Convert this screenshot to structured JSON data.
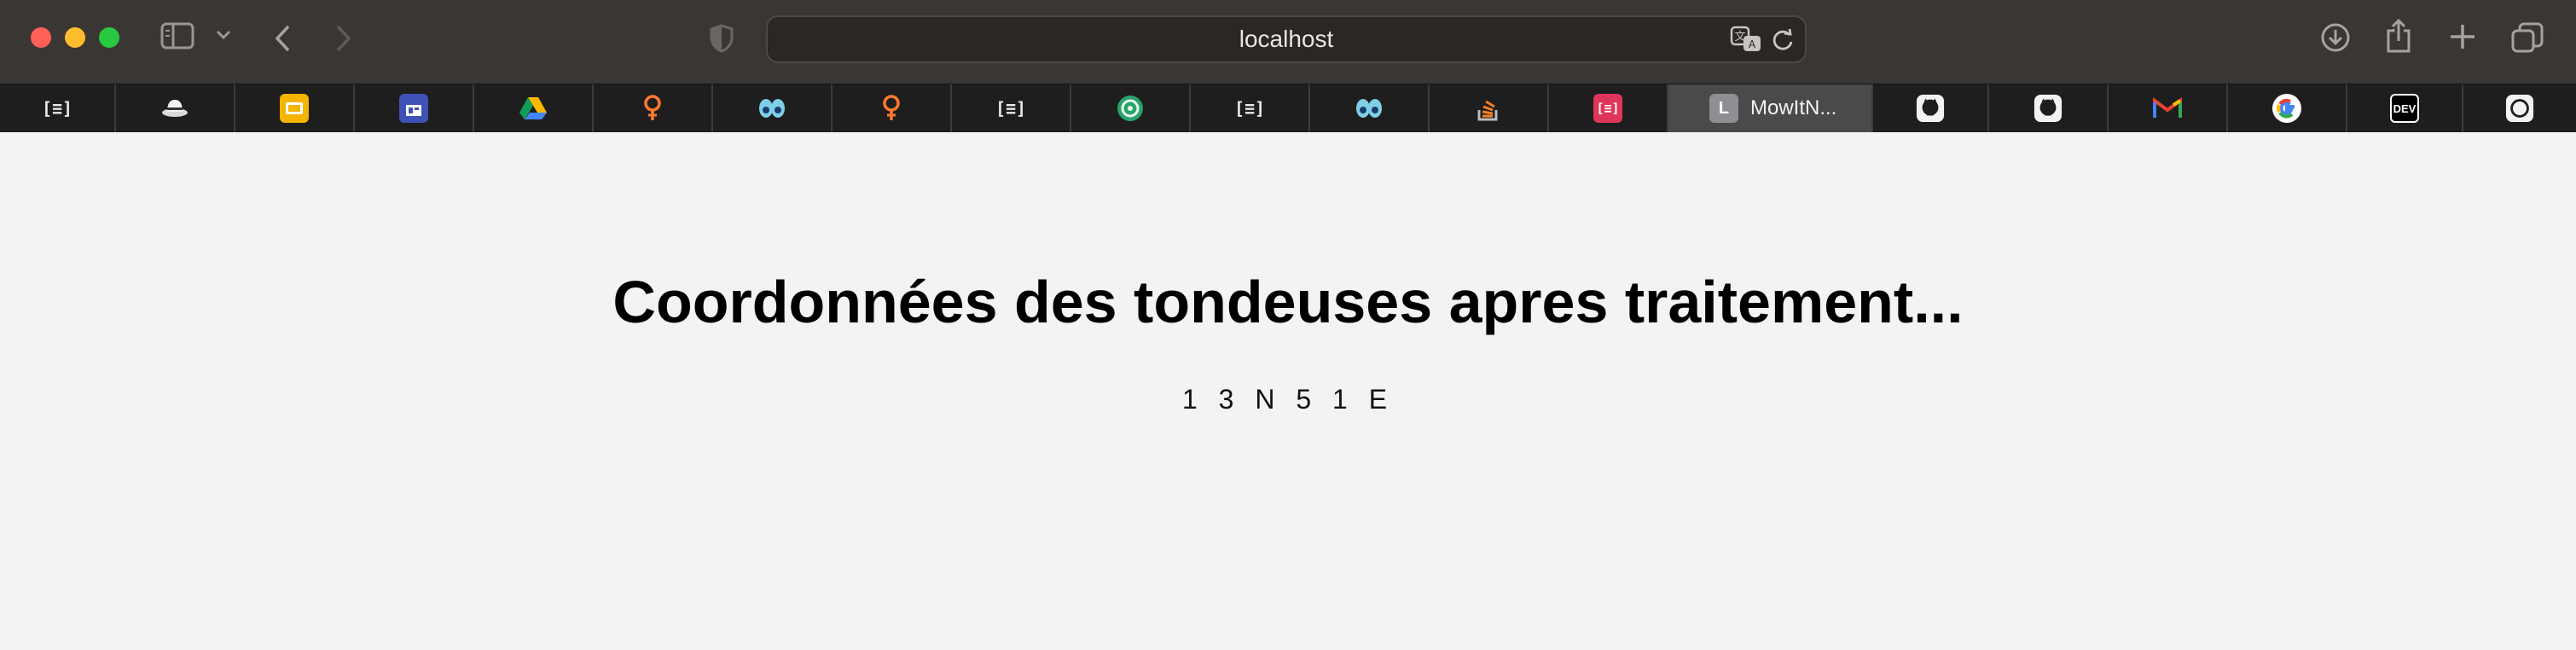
{
  "browser": {
    "address": "localhost",
    "tabs": [
      {
        "icon": "reader-icon",
        "glyph": "[≡]"
      },
      {
        "icon": "hat-icon",
        "glyph": ""
      },
      {
        "icon": "slides-icon",
        "glyph": ""
      },
      {
        "icon": "forms-icon",
        "glyph": ""
      },
      {
        "icon": "drive-icon",
        "glyph": ""
      },
      {
        "icon": "pin-icon",
        "glyph": ""
      },
      {
        "icon": "eyes-icon",
        "glyph": ""
      },
      {
        "icon": "pin-icon",
        "glyph": ""
      },
      {
        "icon": "reader-icon",
        "glyph": "[≡]"
      },
      {
        "icon": "circle-green-icon",
        "glyph": ""
      },
      {
        "icon": "reader-icon",
        "glyph": "[≡]"
      },
      {
        "icon": "eyes-icon",
        "glyph": ""
      },
      {
        "icon": "stackoverflow-icon",
        "glyph": ""
      },
      {
        "icon": "reader-red-icon",
        "glyph": "[≡]"
      },
      {
        "icon": "letter-icon",
        "glyph": "L",
        "label": "MowItN...",
        "active": true
      },
      {
        "icon": "github-icon",
        "glyph": ""
      },
      {
        "icon": "github-icon",
        "glyph": ""
      },
      {
        "icon": "gmail-icon",
        "glyph": "M"
      },
      {
        "icon": "google-icon",
        "glyph": "G"
      },
      {
        "icon": "dev-icon",
        "glyph": "DEV"
      },
      {
        "icon": "circle-outline-icon",
        "glyph": ""
      }
    ]
  },
  "page": {
    "title": "Coordonnées des tondeuses apres traitement...",
    "result": "1 3 N 5 1 E"
  }
}
